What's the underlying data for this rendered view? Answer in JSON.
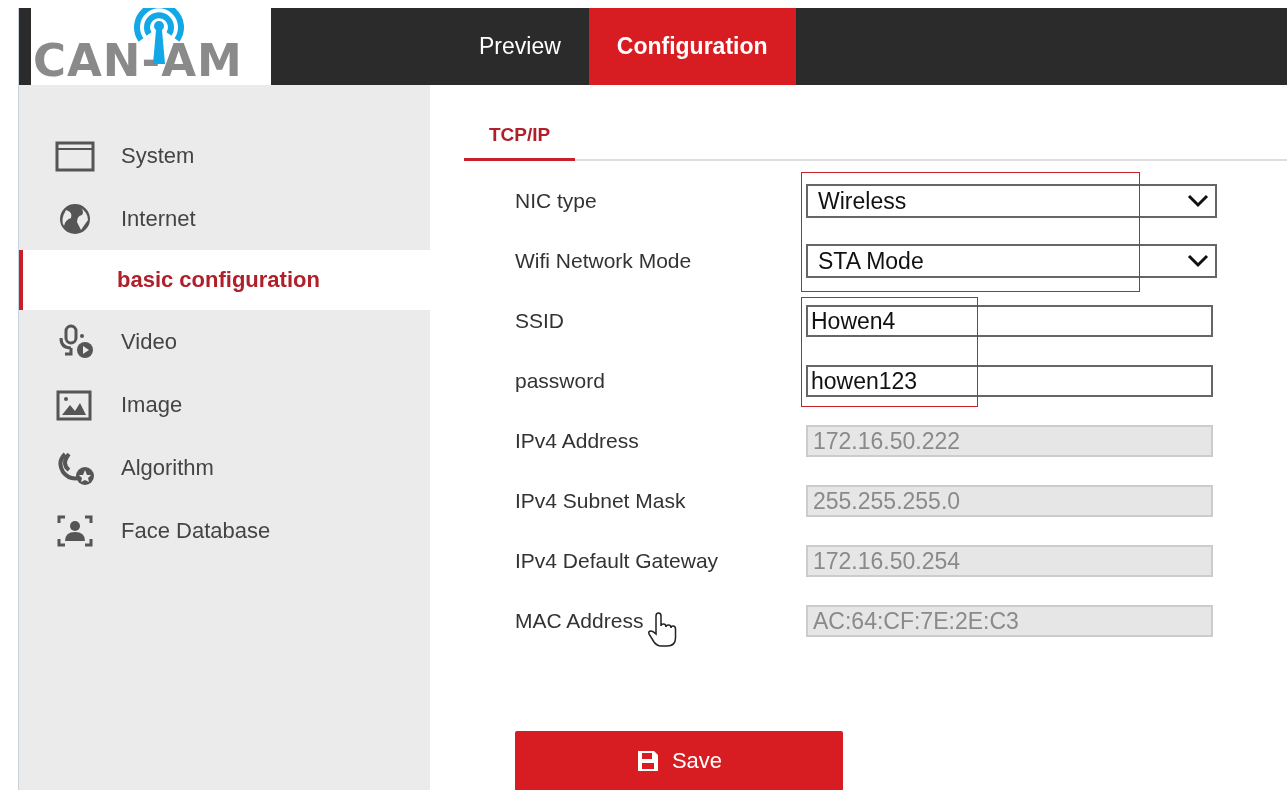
{
  "logo": {
    "text": "CAN-AM"
  },
  "nav_tabs": [
    {
      "label": "Preview",
      "selected": false
    },
    {
      "label": "Configuration",
      "selected": true
    }
  ],
  "sidebar": {
    "items": [
      {
        "label": "System",
        "kind": "window"
      },
      {
        "label": "Internet",
        "kind": "globe",
        "children": [
          {
            "label": "basic configuration",
            "selected": true
          }
        ]
      },
      {
        "label": "Video",
        "kind": "camera"
      },
      {
        "label": "Image",
        "kind": "image"
      },
      {
        "label": "Algorithm",
        "kind": "algorithm"
      },
      {
        "label": "Face Database",
        "kind": "face"
      }
    ]
  },
  "section_tab": {
    "label": "TCP/IP",
    "selected": true
  },
  "fields": [
    {
      "label": "NIC type",
      "kind": "select",
      "value": "Wireless",
      "disabled": false,
      "highlighted": true
    },
    {
      "label": "Wifi Network Mode",
      "kind": "select",
      "value": "STA Mode",
      "disabled": false,
      "highlighted": true
    },
    {
      "label": "SSID",
      "kind": "text",
      "value": "Howen4",
      "disabled": false,
      "highlighted": true
    },
    {
      "label": "password",
      "kind": "text",
      "value": "howen123",
      "disabled": false,
      "highlighted": true
    },
    {
      "label": "IPv4 Address",
      "kind": "text",
      "value": "172.16.50.222",
      "disabled": true
    },
    {
      "label": "IPv4 Subnet Mask",
      "kind": "text",
      "value": "255.255.255.0",
      "disabled": true
    },
    {
      "label": "IPv4 Default Gateway",
      "kind": "text",
      "value": "172.16.50.254",
      "disabled": true
    },
    {
      "label": "MAC Address",
      "kind": "text",
      "value": "AC:64:CF:7E:2E:C3",
      "disabled": true
    }
  ],
  "save_button": {
    "label": "Save"
  }
}
